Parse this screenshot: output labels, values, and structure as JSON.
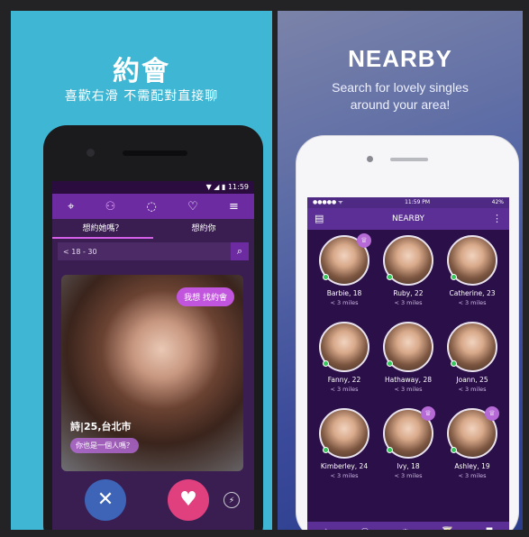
{
  "left_panel": {
    "title": "約會",
    "subtitle": "喜歡右滑 不需配對直接聊",
    "status_time": "11:59",
    "nav_icons": [
      "location-icon",
      "couple-icon",
      "chat-icon",
      "heartbeat-icon",
      "menu-icon"
    ],
    "tabs": [
      {
        "label": "想約她嗎？",
        "active": true
      },
      {
        "label": "想約你",
        "active": false
      }
    ],
    "search": {
      "value": "< 18 - 30"
    },
    "card": {
      "bubble": "我想 找約會",
      "name_location": "詩|25,台北市",
      "message": "你也是一個人嗎？"
    },
    "actions": [
      "reject-icon",
      "like-icon",
      "boost-icon"
    ]
  },
  "right_panel": {
    "title": "NEARBY",
    "subtitle_line1": "Search for lovely singles",
    "subtitle_line2": "around your area!",
    "status_left": "●●●●● ᯤ",
    "status_time": "11:59 PM",
    "status_right": "42%",
    "nav_title": "NEARBY",
    "profiles": [
      {
        "name": "Barbie, 18",
        "distance": "< 3 miles",
        "online": true,
        "vip": true
      },
      {
        "name": "Ruby, 22",
        "distance": "< 3 miles",
        "online": true,
        "vip": false
      },
      {
        "name": "Catherine, 23",
        "distance": "< 3 miles",
        "online": true,
        "vip": false
      },
      {
        "name": "Fanny, 22",
        "distance": "< 3 miles",
        "online": true,
        "vip": false
      },
      {
        "name": "Hathaway, 28",
        "distance": "< 3 miles",
        "online": true,
        "vip": false
      },
      {
        "name": "Joann, 25",
        "distance": "< 3 miles",
        "online": true,
        "vip": false
      },
      {
        "name": "Kimberley, 24",
        "distance": "< 3 miles",
        "online": true,
        "vip": false
      },
      {
        "name": "Ivy, 18",
        "distance": "< 3 miles",
        "online": true,
        "vip": true
      },
      {
        "name": "Ashley, 19",
        "distance": "< 3 miles",
        "online": true,
        "vip": true
      }
    ],
    "tabbar_icons": [
      "location-icon",
      "couple-icon",
      "chat-icon",
      "drink-icon",
      "camera-icon"
    ]
  }
}
